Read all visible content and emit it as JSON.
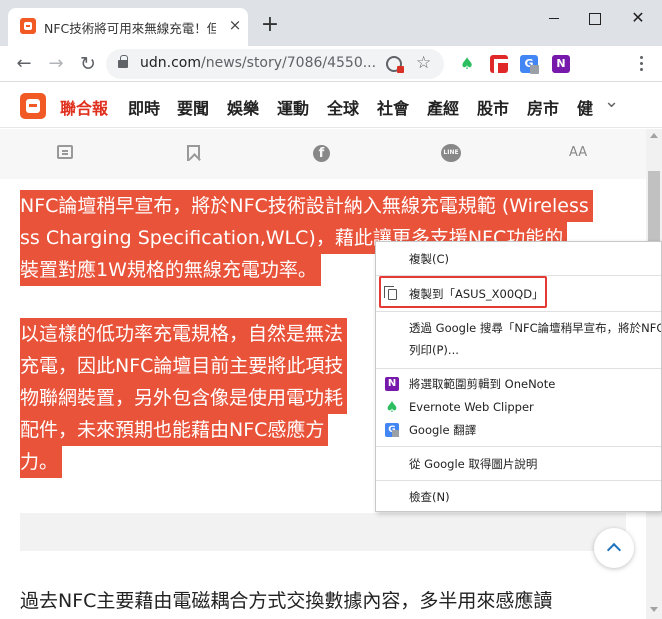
{
  "browser": {
    "tab_title": "NFC技術將可用來無線充電！但就",
    "tab_close": "×",
    "new_tab": "+",
    "url_host": "udn.com",
    "url_path": "/news/story/7086/4550...",
    "window_close": "✕"
  },
  "site": {
    "name": "聯合報",
    "nav_items": [
      "即時",
      "要聞",
      "娛樂",
      "運動",
      "全球",
      "社會",
      "產經",
      "股市",
      "房市",
      "健"
    ],
    "more": "⌄",
    "fontsize_label": "AA"
  },
  "article": {
    "para1": [
      "NFC論壇稍早宣布，將於NFC技術設計納入無線充電規範 (Wireless",
      "ss Charging Specification,WLC)，藉此讓更多支援NFC功能的",
      "裝置對應1W規格的無線充電功率。"
    ],
    "para2": [
      "以這樣的低功率充電規格，自然是無法",
      "充電，因此NFC論壇目前主要將此項技",
      "物聯網裝置，另外包含像是使用電功耗",
      "配件，未來預期也能藉由NFC感應方",
      "力。"
    ],
    "para3": "過去NFC主要藉由電磁耦合方式交換數據內容，多半用來感應讀"
  },
  "context_menu": {
    "items": [
      {
        "label": "複製(C)",
        "icon": ""
      },
      {
        "label": "複製到「ASUS_X00QD」",
        "icon": "copy-icon"
      },
      {
        "label": "透過 Google 搜尋「NFC論壇稍早宣布，將於NFC技術設計納入」",
        "icon": ""
      },
      {
        "label": "列印(P)...",
        "icon": ""
      },
      {
        "label": "將選取範圍剪輯到 OneNote",
        "icon": "onenote-icon"
      },
      {
        "label": "Evernote Web Clipper",
        "icon": "evernote-icon"
      },
      {
        "label": "Google 翻譯",
        "icon": "google-translate-icon"
      },
      {
        "label": "從 Google 取得圖片說明",
        "icon": ""
      },
      {
        "label": "檢查(N)",
        "icon": ""
      }
    ]
  },
  "colors": {
    "accent": "#e0301e",
    "highlight": "#e8533a",
    "callout": "#e53935"
  }
}
